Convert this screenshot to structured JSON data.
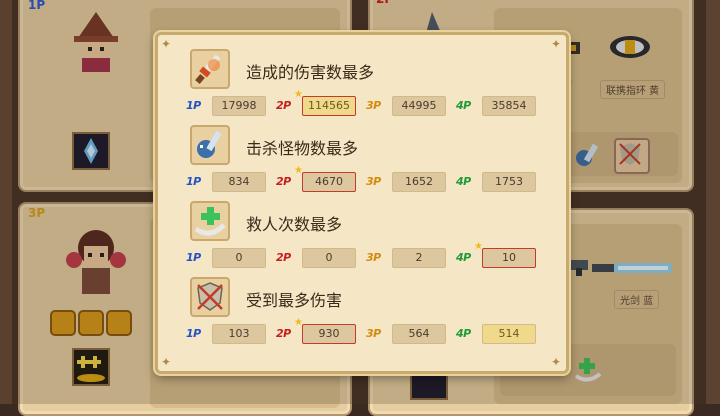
{
  "players": {
    "p1_tag": "1P",
    "p2_tag": "2P",
    "p3_tag": "3P",
    "p2_ring": "联携指环 黄",
    "p4_weapon": "光剑 蓝"
  },
  "stats": [
    {
      "title": "造成的伤害数最多",
      "icon": "sword-icon",
      "values": [
        "17998",
        "114565",
        "44995",
        "35854"
      ],
      "winner": 1
    },
    {
      "title": "击杀怪物数最多",
      "icon": "kill-icon",
      "values": [
        "834",
        "4670",
        "1652",
        "1753"
      ],
      "winner": 1
    },
    {
      "title": "救人次数最多",
      "icon": "rescue-icon",
      "values": [
        "0",
        "0",
        "2",
        "10"
      ],
      "winner": 3
    },
    {
      "title": "受到最多伤害",
      "icon": "shield-icon",
      "values": [
        "103",
        "930",
        "564",
        "514"
      ],
      "winner": 1
    }
  ],
  "labels": [
    "1P",
    "2P",
    "3P",
    "4P"
  ],
  "colors": {
    "p1": "#2453c6",
    "p2": "#c61f1f",
    "p3": "#d38a10",
    "p4": "#1e9a3a",
    "panel": "#f5e7c6"
  }
}
